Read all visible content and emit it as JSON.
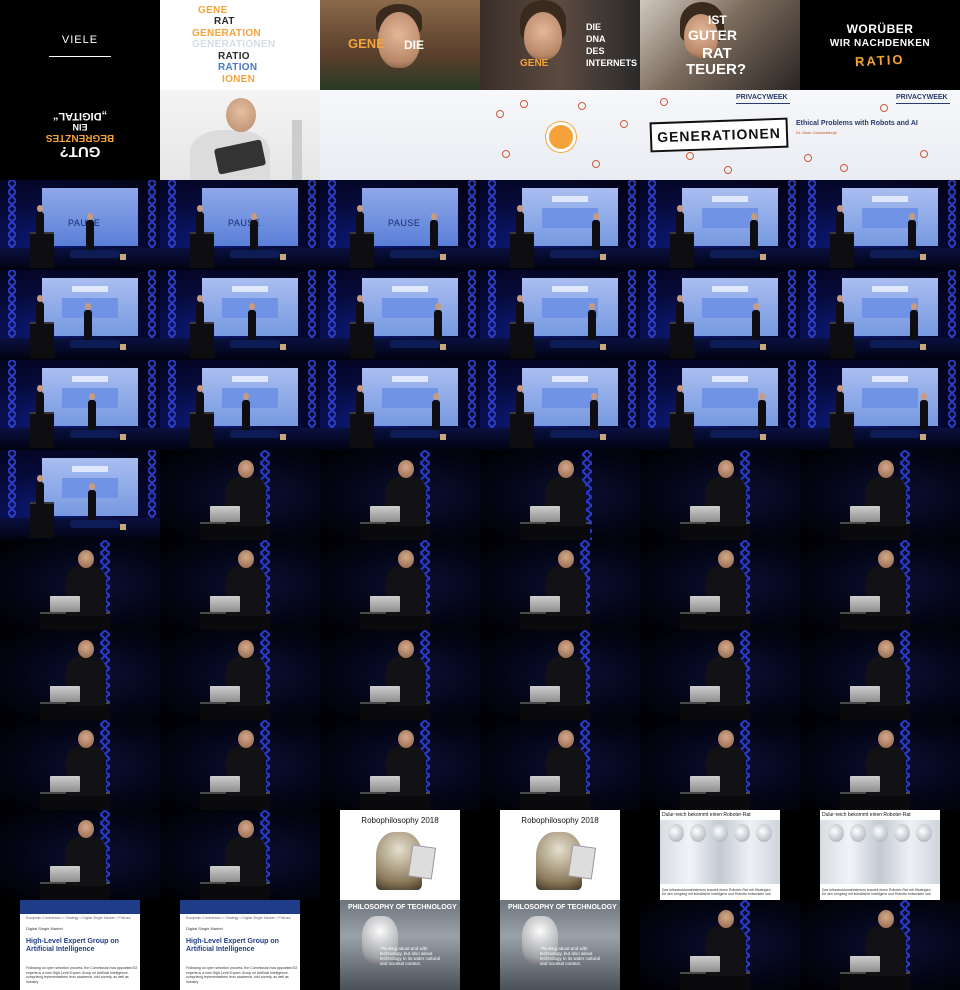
{
  "intro": {
    "viele": "VIELE",
    "word_stack": [
      {
        "text": "GENE",
        "color": "#f5a23a"
      },
      {
        "text": "RAT",
        "color": "#2a2a2a"
      },
      {
        "text": "GENERATION",
        "color": "#f5a23a"
      },
      {
        "text": "GENERATIONEN",
        "color": "#d7dbe6"
      },
      {
        "text": "RATIO",
        "color": "#2a2a2a"
      },
      {
        "text": "RATION",
        "color": "#4a78c4"
      },
      {
        "text": "IONEN",
        "color": "#f5a23a"
      }
    ],
    "boy": {
      "gene": "GENE",
      "die": "DIE"
    },
    "girl": {
      "die": "DIE",
      "dna": "DNA",
      "des": "DES",
      "gene": "GENE",
      "internets": "INTERNETS"
    },
    "woman": {
      "ist": "IST",
      "guter": "GUTER",
      "rat": "RAT",
      "teuer": "TEUER?"
    },
    "woruber": {
      "l1": "WORÜBER",
      "l2": "WIR NACHDENKEN",
      "l3": "RATIO"
    },
    "mirror": {
      "a": "GUT?",
      "b": "BEGRENZTES",
      "c": "EIN",
      "d": "„DIGITAL“"
    }
  },
  "banner": {
    "privacyweek_1": "PRIVACYWEEK",
    "privacyweek_2": "PRIVACYWEEK",
    "generationen": "GENERATIONEN",
    "ethics_title": "Ethical Problems with Robots and AI",
    "ethics_author": "Dr. Mark Coeckelbergh"
  },
  "stage": {
    "pause_label": "PAUSE"
  },
  "slides": {
    "robophilosophy": "Robophilosophy 2018",
    "robots_title": "Dulur-reich bekommt einen Roboter-Rat",
    "robots_caption": "Das Infrastrukturministerium braucht einen Roboter-Rat mit Strategien für den Umgang mit künstlicher Intelligenz und Robotik entwickeln soll.",
    "philosophy": "PHILOSOPHY OF TECHNOLOGY",
    "philosophy_quote": "Thinking about and with technology, but also about technology in its wider cultural and societal context.",
    "eu_crumb": "European Commission > Strategy > Digital Single Market > Policies",
    "eu_sub": "Digital Single Market",
    "eu_title": "High-Level Expert Group on Artificial Intelligence",
    "eu_body": "Following an open selection process, the Commission has appointed 52 experts to a new High-Level Expert Group on Artificial Intelligence, comprising representatives from academia, civil society, as well as industry."
  }
}
